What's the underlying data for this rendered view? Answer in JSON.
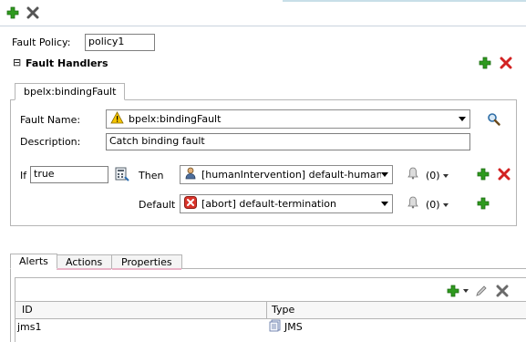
{
  "toolbar": {
    "add_icon": "add-icon",
    "delete_icon": "delete-icon"
  },
  "fault_policy": {
    "label": "Fault Policy:",
    "value": "policy1"
  },
  "fault_handlers": {
    "title": "Fault Handlers",
    "expander": "⊟",
    "tab_label": "bpelx:bindingFault",
    "fault_name_label": "Fault Name:",
    "fault_name_value": "bpelx:bindingFault",
    "description_label": "Description:",
    "description_value": "Catch binding fault",
    "if_label": "If",
    "if_value": "true",
    "then_label": "Then",
    "then_action": "[humanIntervention] default-human",
    "then_alert_count": "(0)",
    "default_label": "Default",
    "default_action": "[abort] default-termination",
    "default_alert_count": "(0)"
  },
  "bottom_tabs": [
    {
      "label": "Alerts"
    },
    {
      "label": "Actions"
    },
    {
      "label": "Properties"
    }
  ],
  "alerts_table": {
    "columns": [
      "ID",
      "Type"
    ],
    "rows": [
      {
        "id": "jms1",
        "type": "JMS"
      }
    ]
  },
  "colors": {
    "add_green": "#2e9a1e",
    "delete_red": "#d22222",
    "warning_yellow": "#f5c400",
    "abort_red": "#d9342b",
    "tab_underline_pink": "#e9b3c7"
  }
}
